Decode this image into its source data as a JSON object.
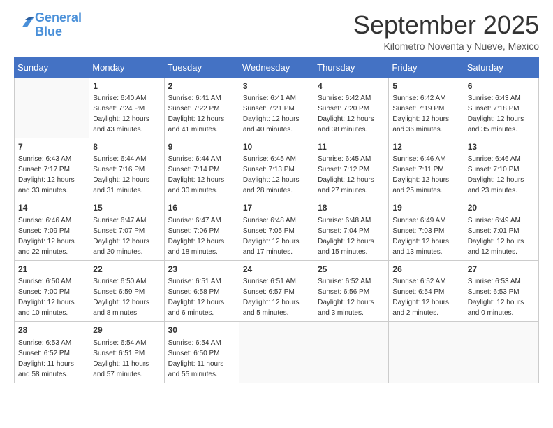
{
  "header": {
    "logo_general": "General",
    "logo_blue": "Blue",
    "month_title": "September 2025",
    "location": "Kilometro Noventa y Nueve, Mexico"
  },
  "days_of_week": [
    "Sunday",
    "Monday",
    "Tuesday",
    "Wednesday",
    "Thursday",
    "Friday",
    "Saturday"
  ],
  "weeks": [
    [
      {
        "day": "",
        "info": ""
      },
      {
        "day": "1",
        "info": "Sunrise: 6:40 AM\nSunset: 7:24 PM\nDaylight: 12 hours\nand 43 minutes."
      },
      {
        "day": "2",
        "info": "Sunrise: 6:41 AM\nSunset: 7:22 PM\nDaylight: 12 hours\nand 41 minutes."
      },
      {
        "day": "3",
        "info": "Sunrise: 6:41 AM\nSunset: 7:21 PM\nDaylight: 12 hours\nand 40 minutes."
      },
      {
        "day": "4",
        "info": "Sunrise: 6:42 AM\nSunset: 7:20 PM\nDaylight: 12 hours\nand 38 minutes."
      },
      {
        "day": "5",
        "info": "Sunrise: 6:42 AM\nSunset: 7:19 PM\nDaylight: 12 hours\nand 36 minutes."
      },
      {
        "day": "6",
        "info": "Sunrise: 6:43 AM\nSunset: 7:18 PM\nDaylight: 12 hours\nand 35 minutes."
      }
    ],
    [
      {
        "day": "7",
        "info": "Sunrise: 6:43 AM\nSunset: 7:17 PM\nDaylight: 12 hours\nand 33 minutes."
      },
      {
        "day": "8",
        "info": "Sunrise: 6:44 AM\nSunset: 7:16 PM\nDaylight: 12 hours\nand 31 minutes."
      },
      {
        "day": "9",
        "info": "Sunrise: 6:44 AM\nSunset: 7:14 PM\nDaylight: 12 hours\nand 30 minutes."
      },
      {
        "day": "10",
        "info": "Sunrise: 6:45 AM\nSunset: 7:13 PM\nDaylight: 12 hours\nand 28 minutes."
      },
      {
        "day": "11",
        "info": "Sunrise: 6:45 AM\nSunset: 7:12 PM\nDaylight: 12 hours\nand 27 minutes."
      },
      {
        "day": "12",
        "info": "Sunrise: 6:46 AM\nSunset: 7:11 PM\nDaylight: 12 hours\nand 25 minutes."
      },
      {
        "day": "13",
        "info": "Sunrise: 6:46 AM\nSunset: 7:10 PM\nDaylight: 12 hours\nand 23 minutes."
      }
    ],
    [
      {
        "day": "14",
        "info": "Sunrise: 6:46 AM\nSunset: 7:09 PM\nDaylight: 12 hours\nand 22 minutes."
      },
      {
        "day": "15",
        "info": "Sunrise: 6:47 AM\nSunset: 7:07 PM\nDaylight: 12 hours\nand 20 minutes."
      },
      {
        "day": "16",
        "info": "Sunrise: 6:47 AM\nSunset: 7:06 PM\nDaylight: 12 hours\nand 18 minutes."
      },
      {
        "day": "17",
        "info": "Sunrise: 6:48 AM\nSunset: 7:05 PM\nDaylight: 12 hours\nand 17 minutes."
      },
      {
        "day": "18",
        "info": "Sunrise: 6:48 AM\nSunset: 7:04 PM\nDaylight: 12 hours\nand 15 minutes."
      },
      {
        "day": "19",
        "info": "Sunrise: 6:49 AM\nSunset: 7:03 PM\nDaylight: 12 hours\nand 13 minutes."
      },
      {
        "day": "20",
        "info": "Sunrise: 6:49 AM\nSunset: 7:01 PM\nDaylight: 12 hours\nand 12 minutes."
      }
    ],
    [
      {
        "day": "21",
        "info": "Sunrise: 6:50 AM\nSunset: 7:00 PM\nDaylight: 12 hours\nand 10 minutes."
      },
      {
        "day": "22",
        "info": "Sunrise: 6:50 AM\nSunset: 6:59 PM\nDaylight: 12 hours\nand 8 minutes."
      },
      {
        "day": "23",
        "info": "Sunrise: 6:51 AM\nSunset: 6:58 PM\nDaylight: 12 hours\nand 6 minutes."
      },
      {
        "day": "24",
        "info": "Sunrise: 6:51 AM\nSunset: 6:57 PM\nDaylight: 12 hours\nand 5 minutes."
      },
      {
        "day": "25",
        "info": "Sunrise: 6:52 AM\nSunset: 6:56 PM\nDaylight: 12 hours\nand 3 minutes."
      },
      {
        "day": "26",
        "info": "Sunrise: 6:52 AM\nSunset: 6:54 PM\nDaylight: 12 hours\nand 2 minutes."
      },
      {
        "day": "27",
        "info": "Sunrise: 6:53 AM\nSunset: 6:53 PM\nDaylight: 12 hours\nand 0 minutes."
      }
    ],
    [
      {
        "day": "28",
        "info": "Sunrise: 6:53 AM\nSunset: 6:52 PM\nDaylight: 11 hours\nand 58 minutes."
      },
      {
        "day": "29",
        "info": "Sunrise: 6:54 AM\nSunset: 6:51 PM\nDaylight: 11 hours\nand 57 minutes."
      },
      {
        "day": "30",
        "info": "Sunrise: 6:54 AM\nSunset: 6:50 PM\nDaylight: 11 hours\nand 55 minutes."
      },
      {
        "day": "",
        "info": ""
      },
      {
        "day": "",
        "info": ""
      },
      {
        "day": "",
        "info": ""
      },
      {
        "day": "",
        "info": ""
      }
    ]
  ]
}
